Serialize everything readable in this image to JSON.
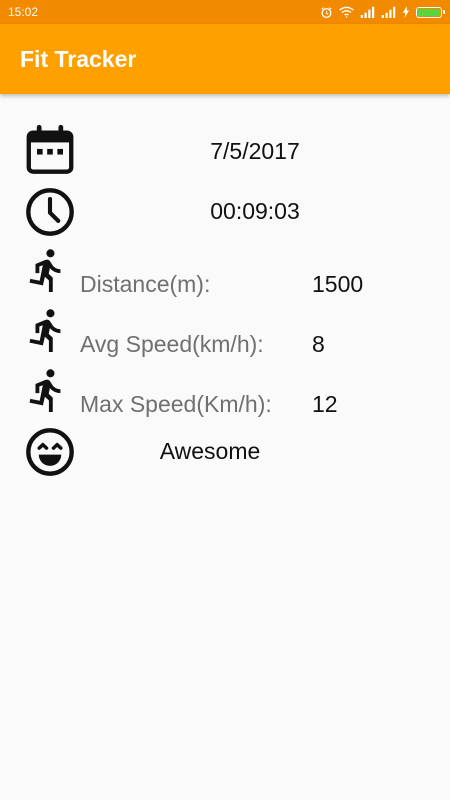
{
  "status_bar": {
    "time": "15:02",
    "icons": [
      "alarm-icon",
      "wifi-icon",
      "signal-icon",
      "signal-icon",
      "charging-icon",
      "battery-icon"
    ],
    "battery_level": 1.0,
    "battery_color": "#5bd53b"
  },
  "app_bar": {
    "title": "Fit Tracker",
    "color": "#ffa000"
  },
  "workout": {
    "date": "7/5/2017",
    "duration": "00:09:03",
    "stats": [
      {
        "label": "Distance(m):",
        "value": "1500"
      },
      {
        "label": "Avg Speed(km/h):",
        "value": "8"
      },
      {
        "label": "Max Speed(Km/h):",
        "value": "12"
      }
    ],
    "mood": "Awesome"
  }
}
